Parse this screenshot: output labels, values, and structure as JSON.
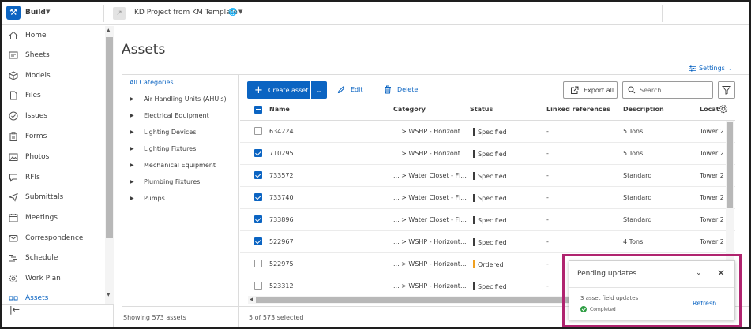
{
  "topbar": {
    "app_name": "Build",
    "project_name": "KD Project from KM Template"
  },
  "sidebar": {
    "items": [
      {
        "label": "Home",
        "icon": "home-icon"
      },
      {
        "label": "Sheets",
        "icon": "sheets-icon"
      },
      {
        "label": "Models",
        "icon": "cube-icon"
      },
      {
        "label": "Files",
        "icon": "file-icon"
      },
      {
        "label": "Issues",
        "icon": "check-circle-icon"
      },
      {
        "label": "Forms",
        "icon": "clipboard-icon"
      },
      {
        "label": "Photos",
        "icon": "photo-icon"
      },
      {
        "label": "RFIs",
        "icon": "chat-icon"
      },
      {
        "label": "Submittals",
        "icon": "submittal-icon"
      },
      {
        "label": "Meetings",
        "icon": "calendar-icon"
      },
      {
        "label": "Correspondence",
        "icon": "mail-icon"
      },
      {
        "label": "Schedule",
        "icon": "schedule-icon"
      },
      {
        "label": "Work Plan",
        "icon": "gear-icon"
      },
      {
        "label": "Assets",
        "icon": "assets-icon"
      }
    ]
  },
  "page": {
    "title": "Assets",
    "settings_label": "Settings"
  },
  "categories": {
    "all_label": "All Categories",
    "items": [
      "Air Handling Units (AHU's)",
      "Electrical Equipment",
      "Lighting Devices",
      "Lighting Fixtures",
      "Mechanical Equipment",
      "Plumbing Fixtures",
      "Pumps"
    ],
    "footer": "Showing 573 assets"
  },
  "toolbar": {
    "create_label": "Create asset",
    "edit_label": "Edit",
    "delete_label": "Delete",
    "export_label": "Export all",
    "search_placeholder": "Search..."
  },
  "table": {
    "columns": [
      "Name",
      "Category",
      "Status",
      "Linked references",
      "Description",
      "Locat"
    ],
    "rows": [
      {
        "name": "634224",
        "category": "... > WSHP - Horizont...",
        "status": "Specified",
        "linked": "-",
        "description": "5 Tons",
        "location": "Tower 2",
        "checked": false
      },
      {
        "name": "710295",
        "category": "... > WSHP - Horizont...",
        "status": "Specified",
        "linked": "-",
        "description": "5 Tons",
        "location": "Tower 2",
        "checked": true
      },
      {
        "name": "733572",
        "category": "... > Water Closet - Fl...",
        "status": "Specified",
        "linked": "-",
        "description": "Standard",
        "location": "Tower 2",
        "checked": true
      },
      {
        "name": "733740",
        "category": "... > Water Closet - Fl...",
        "status": "Specified",
        "linked": "-",
        "description": "Standard",
        "location": "Tower 2",
        "checked": true
      },
      {
        "name": "733896",
        "category": "... > Water Closet - Fl...",
        "status": "Specified",
        "linked": "-",
        "description": "Standard",
        "location": "Tower 2",
        "checked": true
      },
      {
        "name": "522967",
        "category": "... > WSHP - Horizont...",
        "status": "Specified",
        "linked": "-",
        "description": "4 Tons",
        "location": "Tower 2",
        "checked": true
      },
      {
        "name": "522975",
        "category": "... > WSHP - Horizont...",
        "status": "Ordered",
        "linked": "-",
        "description": "",
        "location": "",
        "checked": false
      },
      {
        "name": "523312",
        "category": "... > WSHP - Horizont...",
        "status": "Specified",
        "linked": "-",
        "description": "",
        "location": "",
        "checked": false
      }
    ],
    "selected_text": "5 of 573 selected"
  },
  "status_colors": {
    "Specified": "#3c3c3c",
    "Ordered": "#f0a020"
  },
  "popup": {
    "title": "Pending updates",
    "message": "3 asset field updates",
    "status": "Completed",
    "refresh_label": "Refresh"
  }
}
